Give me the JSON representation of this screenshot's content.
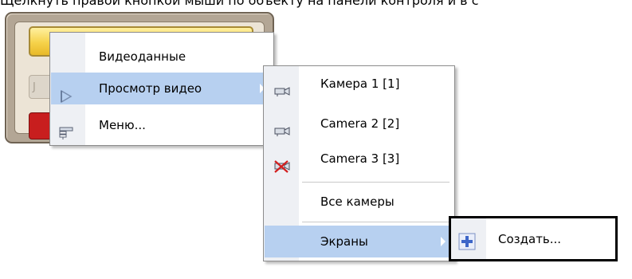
{
  "caption": "Щелкнуть правой кнопкой мыши по объекту на панели контроля и в с",
  "main_menu": {
    "items": [
      {
        "label": "Видеоданные",
        "icon": null,
        "has_submenu": false,
        "highlighted": false
      },
      {
        "label": "Просмотр видео",
        "icon": "play-outline-icon",
        "has_submenu": true,
        "highlighted": true
      },
      {
        "label": "Меню...",
        "icon": "menu-list-icon",
        "has_submenu": false,
        "highlighted": false
      }
    ]
  },
  "camera_menu": {
    "items": [
      {
        "label": "Камера 1 [1]",
        "icon": "camera-icon",
        "highlighted": false
      },
      {
        "label": "Camera 2 [2]",
        "icon": "camera-icon",
        "highlighted": false
      },
      {
        "label": "Camera 3 [3]",
        "icon": "camera-disabled-icon",
        "highlighted": false
      },
      {
        "label": "Все камеры",
        "icon": null,
        "highlighted": false
      },
      {
        "label": "Экраны",
        "icon": null,
        "has_submenu": true,
        "highlighted": true
      }
    ]
  },
  "screens_menu": {
    "items": [
      {
        "label": "Создать...",
        "icon": "plus-icon"
      }
    ]
  },
  "colors": {
    "highlight": "#b7d0f0",
    "menu_strip": "#eef0f4",
    "panel_bg": "#b3a695",
    "yellow_button": "#f6d24a",
    "red_button": "#c81e1e"
  }
}
